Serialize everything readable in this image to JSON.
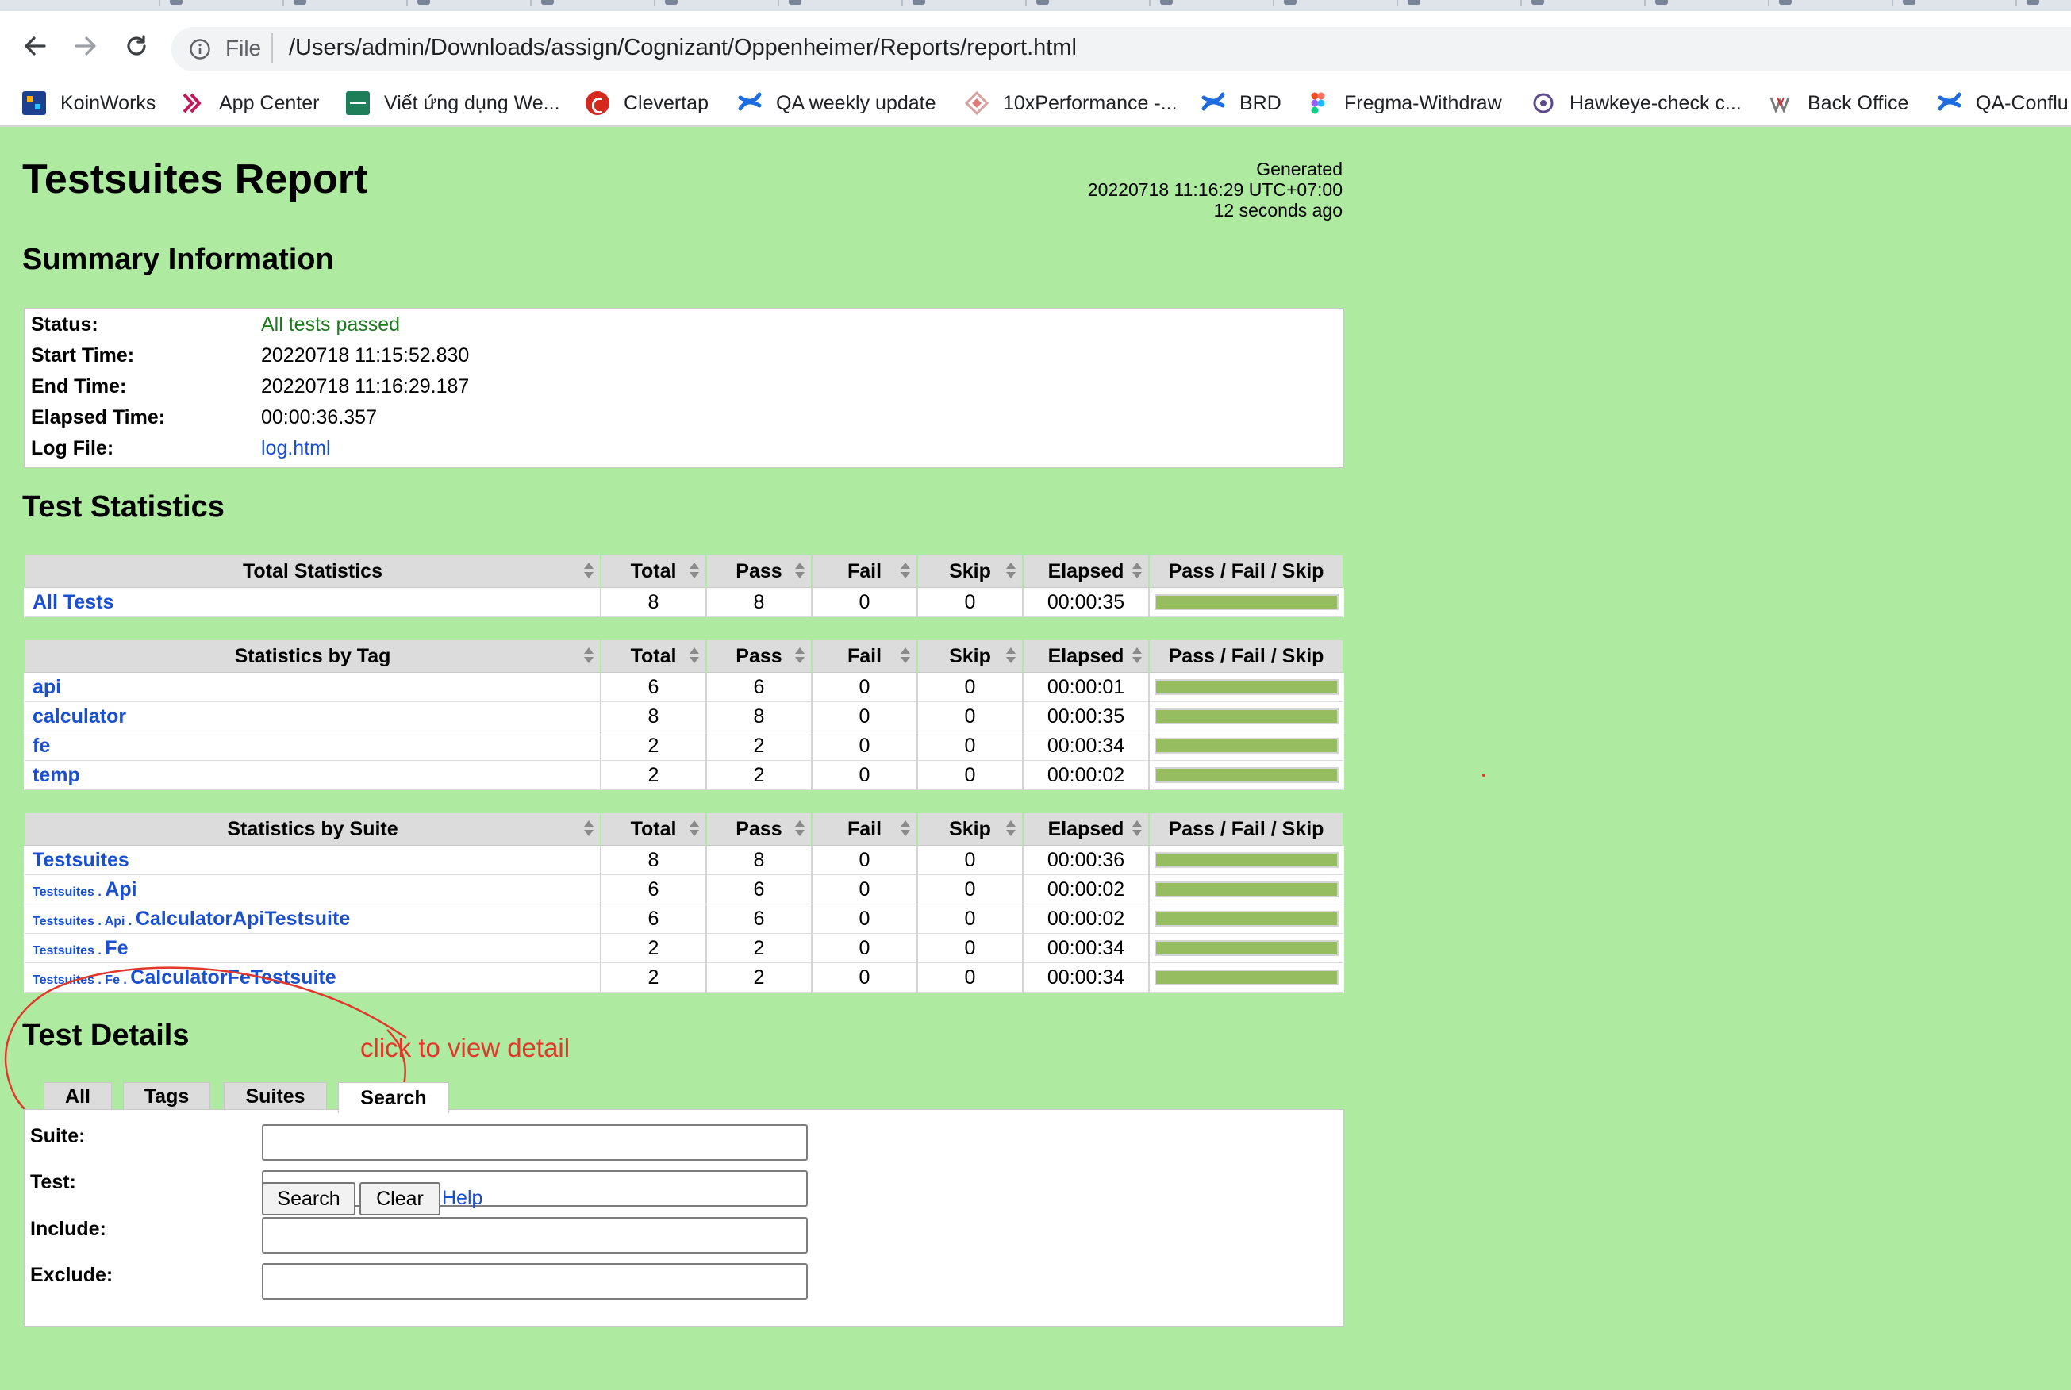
{
  "browser": {
    "url_scheme": "File",
    "url": "/Users/admin/Downloads/assign/Cognizant/Oppenheimer/Reports/report.html",
    "bookmarks": [
      {
        "label": "KoinWorks",
        "icon": "koinworks-icon"
      },
      {
        "label": "App Center",
        "icon": "app-center-icon"
      },
      {
        "label": "Viết ứng dụng We...",
        "icon": "sheet-icon"
      },
      {
        "label": "Clevertap",
        "icon": "clevertap-icon"
      },
      {
        "label": "QA weekly update",
        "icon": "confluence-icon"
      },
      {
        "label": "10xPerformance -...",
        "icon": "diamond-icon"
      },
      {
        "label": "BRD",
        "icon": "confluence-icon"
      },
      {
        "label": "Fregma-Withdraw",
        "icon": "figma-icon"
      },
      {
        "label": "Hawkeye-check c...",
        "icon": "target-icon"
      },
      {
        "label": "Back Office",
        "icon": "w-logo-icon"
      },
      {
        "label": "QA-Conflu",
        "icon": "confluence-icon"
      }
    ]
  },
  "report": {
    "title": "Testsuites Report",
    "generated_label": "Generated",
    "generated_time": "20220718 11:16:29 UTC+07:00",
    "generated_ago": "12 seconds ago",
    "background_color": "#aeeaa0"
  },
  "summary": {
    "heading": "Summary Information",
    "rows": [
      {
        "label": "Status:",
        "value": "All tests passed"
      },
      {
        "label": "Start Time:",
        "value": "20220718 11:15:52.830"
      },
      {
        "label": "End Time:",
        "value": "20220718 11:16:29.187"
      },
      {
        "label": "Elapsed Time:",
        "value": "00:00:36.357"
      },
      {
        "label": "Log File:",
        "value": "log.html"
      }
    ]
  },
  "statistics": {
    "heading": "Test Statistics",
    "columns": [
      "Total",
      "Pass",
      "Fail",
      "Skip",
      "Elapsed",
      "Pass / Fail / Skip"
    ],
    "total": {
      "title": "Total Statistics",
      "rows": [
        {
          "name": "All Tests",
          "total": "8",
          "pass": "8",
          "fail": "0",
          "skip": "0",
          "elapsed": "00:00:35"
        }
      ]
    },
    "by_tag": {
      "title": "Statistics by Tag",
      "rows": [
        {
          "name": "api",
          "total": "6",
          "pass": "6",
          "fail": "0",
          "skip": "0",
          "elapsed": "00:00:01"
        },
        {
          "name": "calculator",
          "total": "8",
          "pass": "8",
          "fail": "0",
          "skip": "0",
          "elapsed": "00:00:35"
        },
        {
          "name": "fe",
          "total": "2",
          "pass": "2",
          "fail": "0",
          "skip": "0",
          "elapsed": "00:00:34"
        },
        {
          "name": "temp",
          "total": "2",
          "pass": "2",
          "fail": "0",
          "skip": "0",
          "elapsed": "00:00:02"
        }
      ]
    },
    "by_suite": {
      "title": "Statistics by Suite",
      "rows": [
        {
          "prefix": "",
          "name": "Testsuites",
          "total": "8",
          "pass": "8",
          "fail": "0",
          "skip": "0",
          "elapsed": "00:00:36"
        },
        {
          "prefix": "Testsuites . ",
          "name": "Api",
          "total": "6",
          "pass": "6",
          "fail": "0",
          "skip": "0",
          "elapsed": "00:00:02"
        },
        {
          "prefix": "Testsuites . Api . ",
          "name": "CalculatorApiTestsuite",
          "total": "6",
          "pass": "6",
          "fail": "0",
          "skip": "0",
          "elapsed": "00:00:02"
        },
        {
          "prefix": "Testsuites . ",
          "name": "Fe",
          "total": "2",
          "pass": "2",
          "fail": "0",
          "skip": "0",
          "elapsed": "00:00:34"
        },
        {
          "prefix": "Testsuites . Fe . ",
          "name": "CalculatorFeTestsuite",
          "total": "2",
          "pass": "2",
          "fail": "0",
          "skip": "0",
          "elapsed": "00:00:34"
        }
      ]
    },
    "pass_ratio": 1.0,
    "pass_color": "#97bd61"
  },
  "details": {
    "heading": "Test Details",
    "annotation": "click to view detail",
    "annotation_color": "#e0392b",
    "tabs": [
      "All",
      "Tags",
      "Suites",
      "Search"
    ],
    "active_tab": "Search",
    "fields": [
      {
        "label": "Suite:",
        "value": ""
      },
      {
        "label": "Test:",
        "value": ""
      },
      {
        "label": "Include:",
        "value": ""
      },
      {
        "label": "Exclude:",
        "value": ""
      }
    ],
    "search_button": "Search",
    "clear_button": "Clear",
    "help_link": "Help"
  }
}
